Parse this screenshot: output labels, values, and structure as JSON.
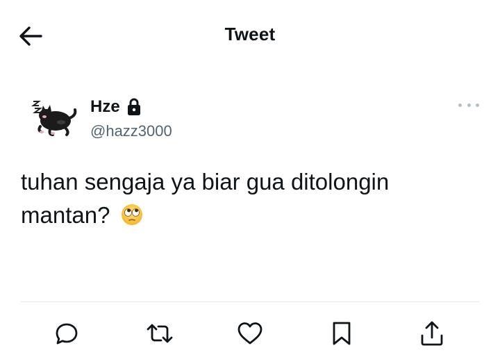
{
  "header": {
    "title": "Tweet",
    "back_icon": "arrow-left-icon"
  },
  "tweet": {
    "author": {
      "name": "Hze",
      "handle": "@hazz3000",
      "protected_icon": "lock-icon",
      "avatar_icon": "sleeping-cat-avatar"
    },
    "text": "tuhan sengaja ya biar gua ditolongin mantan?",
    "emoji": "face-with-rolling-eyes-emoji",
    "more_icon": "more-horizontal-icon"
  },
  "actions": [
    {
      "name": "reply",
      "icon": "reply-icon"
    },
    {
      "name": "retweet",
      "icon": "retweet-icon"
    },
    {
      "name": "like",
      "icon": "heart-icon"
    },
    {
      "name": "bookmark",
      "icon": "bookmark-icon"
    },
    {
      "name": "share",
      "icon": "share-icon"
    }
  ],
  "colors": {
    "text": "#0f1419",
    "secondary_text": "#536471",
    "divider": "#e1e6ea"
  }
}
